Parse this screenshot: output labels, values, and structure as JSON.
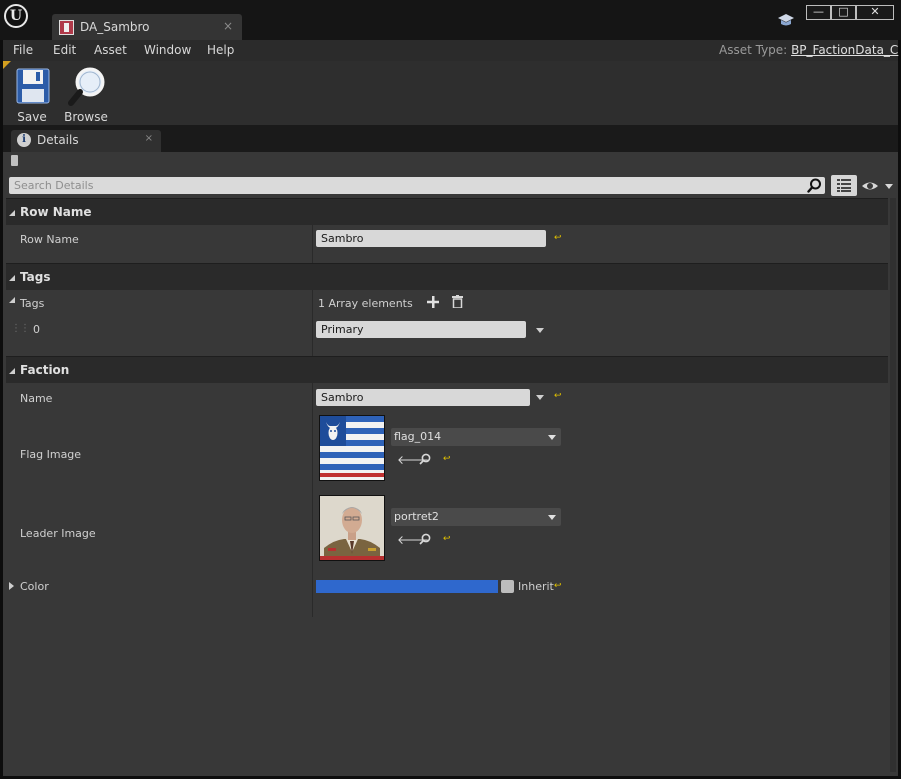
{
  "window": {
    "logo_letter": "U",
    "tab_title": "DA_Sambro",
    "tab_close": "×",
    "controls": {
      "minimize": "—",
      "maximize": "□",
      "close": "✕"
    }
  },
  "menu": {
    "items": [
      "File",
      "Edit",
      "Asset",
      "Window",
      "Help"
    ],
    "asset_type_label": "Asset Type:",
    "asset_type_value": "BP_FactionData_C"
  },
  "toolbar": {
    "save_label": "Save",
    "browse_label": "Browse"
  },
  "details": {
    "tab_label": "Details",
    "tab_icon_letter": "i",
    "tab_close": "×",
    "search_placeholder": "Search Details"
  },
  "categories": {
    "row_name": {
      "title": "Row Name",
      "field_label": "Row Name",
      "value": "Sambro"
    },
    "tags": {
      "title": "Tags",
      "array_label": "Tags",
      "array_count": "1 Array elements",
      "element_index": "0",
      "element_value": "Primary"
    },
    "faction": {
      "title": "Faction",
      "name_label": "Name",
      "name_value": "Sambro",
      "flag_label": "Flag Image",
      "flag_asset": "flag_014",
      "leader_label": "Leader Image",
      "leader_asset": "portret2",
      "color_label": "Color",
      "color_value": "#2f68cd",
      "inherit_label": "Inherit"
    }
  }
}
